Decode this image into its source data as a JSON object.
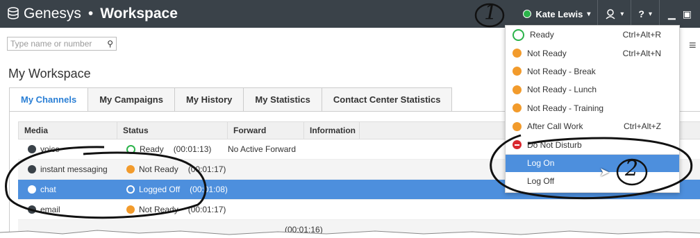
{
  "titlebar": {
    "brand": "Genesys",
    "separator": "•",
    "app_name": "Workspace",
    "user_name": "Kate Lewis",
    "status_color": "#2bb34a"
  },
  "search": {
    "placeholder": "Type name or number"
  },
  "workspace": {
    "title": "My Workspace"
  },
  "tabs": [
    "My Channels",
    "My Campaigns",
    "My History",
    "My Statistics",
    "Contact Center Statistics"
  ],
  "table": {
    "columns": [
      "Media",
      "Status",
      "Forward",
      "Information"
    ],
    "rows": [
      {
        "media": "voice",
        "status": "Ready",
        "duration": "(00:01:13)",
        "forward": "No Active Forward"
      },
      {
        "media": "instant messaging",
        "status": "Not Ready",
        "duration": "(00:01:17)",
        "forward": ""
      },
      {
        "media": "chat",
        "status": "Logged Off",
        "duration": "(00:01:08)",
        "forward": ""
      },
      {
        "media": "email",
        "status": "Not Ready",
        "duration": "(00:01:17)",
        "forward": ""
      },
      {
        "media": "",
        "status": "",
        "duration": "(00:01:16)",
        "forward": ""
      }
    ]
  },
  "status_menu": {
    "items": [
      {
        "label": "Ready",
        "shortcut": "Ctrl+Alt+R",
        "icon": "ready-icon"
      },
      {
        "label": "Not Ready",
        "shortcut": "Ctrl+Alt+N",
        "icon": "clock-icon"
      },
      {
        "label": "Not Ready - Break",
        "shortcut": "",
        "icon": "clock-icon"
      },
      {
        "label": "Not Ready - Lunch",
        "shortcut": "",
        "icon": "clock-icon"
      },
      {
        "label": "Not Ready - Training",
        "shortcut": "",
        "icon": "clock-icon"
      },
      {
        "label": "After Call Work",
        "shortcut": "Ctrl+Alt+Z",
        "icon": "after-call-work-icon"
      },
      {
        "label": "Do Not Disturb",
        "shortcut": "",
        "icon": "do-not-disturb-icon"
      },
      {
        "label": "Log On",
        "shortcut": "",
        "icon": ""
      },
      {
        "label": "Log Off",
        "shortcut": "",
        "icon": ""
      }
    ]
  },
  "annotations": {
    "marker_1": "1",
    "marker_2": "2"
  },
  "colors": {
    "titlebar": "#3a4249",
    "accent": "#4d8fdd",
    "not_ready": "#f29b2c",
    "dnd": "#d9282f"
  }
}
